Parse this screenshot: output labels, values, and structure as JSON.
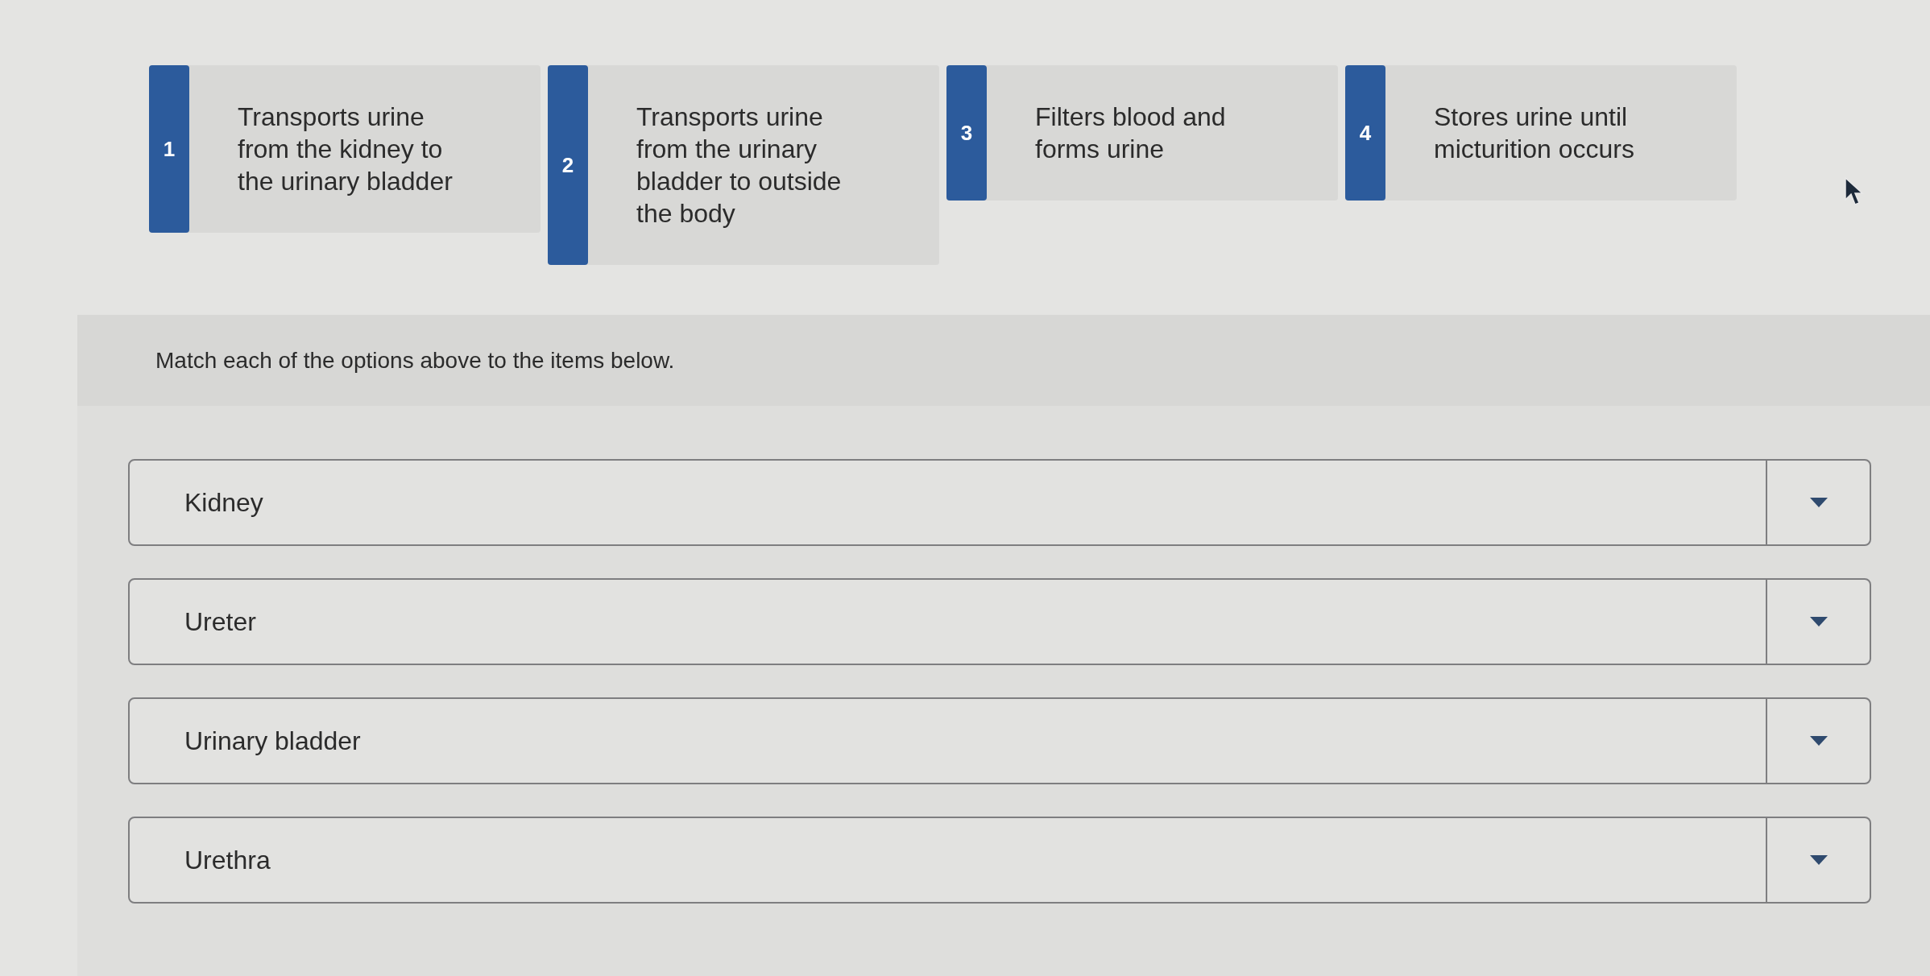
{
  "options": [
    {
      "number": "1",
      "text": "Transports urine from the kidney to the urinary bladder"
    },
    {
      "number": "2",
      "text": "Transports urine from the urinary bladder to outside the body"
    },
    {
      "number": "3",
      "text": "Filters blood and forms urine"
    },
    {
      "number": "4",
      "text": "Stores urine until micturition occurs"
    }
  ],
  "instruction": "Match each of the options above to the items below.",
  "items": [
    {
      "label": "Kidney"
    },
    {
      "label": "Ureter"
    },
    {
      "label": "Urinary bladder"
    },
    {
      "label": "Urethra"
    }
  ]
}
